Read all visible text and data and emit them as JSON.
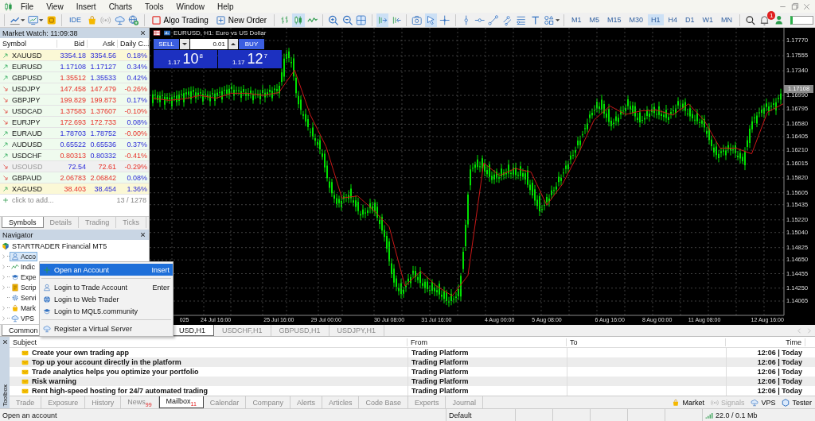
{
  "menu": [
    "File",
    "View",
    "Insert",
    "Charts",
    "Tools",
    "Window",
    "Help"
  ],
  "toolbar": {
    "ide": "IDE",
    "algo_trading": {
      "label": "Algo Trading",
      "on": false
    },
    "new_order": "New Order",
    "chart_modes": [
      {
        "selected": false
      },
      {
        "selected": true
      },
      {
        "selected": false
      }
    ],
    "autoscroll": {
      "on": true
    },
    "chart_shift": {
      "on": false
    },
    "pointer_tools": [
      {
        "selected": true
      },
      {
        "selected": false
      }
    ],
    "timeframes": [
      {
        "label": "M1",
        "selected": false
      },
      {
        "label": "M5",
        "selected": false
      },
      {
        "label": "M15",
        "selected": false
      },
      {
        "label": "M30",
        "selected": false
      },
      {
        "label": "H1",
        "selected": true
      },
      {
        "label": "H4",
        "selected": false
      },
      {
        "label": "D1",
        "selected": false
      },
      {
        "label": "W1",
        "selected": false
      },
      {
        "label": "MN",
        "selected": false
      }
    ],
    "notifications": "1"
  },
  "market_watch": {
    "title": "Market Watch: 11:09:38",
    "columns": [
      "Symbol",
      "Bid",
      "Ask",
      "Daily C..."
    ],
    "rows": [
      {
        "symbol": "XAUUSD",
        "trend_up": true,
        "bid": "3354.18",
        "bid_up": true,
        "ask": "3354.56",
        "ask_up": true,
        "change": "0.18%",
        "change_up": true,
        "highlighted": true,
        "disabled": false
      },
      {
        "symbol": "EURUSD",
        "trend_up": true,
        "bid": "1.17108",
        "bid_up": true,
        "ask": "1.17127",
        "ask_up": true,
        "change": "0.34%",
        "change_up": true,
        "highlighted": false,
        "disabled": false
      },
      {
        "symbol": "GBPUSD",
        "trend_up": true,
        "bid": "1.35512",
        "bid_up": false,
        "ask": "1.35533",
        "ask_up": true,
        "change": "0.42%",
        "change_up": true,
        "highlighted": false,
        "disabled": false
      },
      {
        "symbol": "USDJPY",
        "trend_up": false,
        "bid": "147.458",
        "bid_up": false,
        "ask": "147.479",
        "ask_up": false,
        "change": "-0.26%",
        "change_up": false,
        "highlighted": false,
        "disabled": false
      },
      {
        "symbol": "GBPJPY",
        "trend_up": false,
        "bid": "199.829",
        "bid_up": false,
        "ask": "199.873",
        "ask_up": false,
        "change": "0.17%",
        "change_up": true,
        "highlighted": false,
        "disabled": false
      },
      {
        "symbol": "USDCAD",
        "trend_up": false,
        "bid": "1.37583",
        "bid_up": false,
        "ask": "1.37607",
        "ask_up": false,
        "change": "-0.10%",
        "change_up": false,
        "highlighted": false,
        "disabled": false
      },
      {
        "symbol": "EURJPY",
        "trend_up": false,
        "bid": "172.693",
        "bid_up": false,
        "ask": "172.733",
        "ask_up": false,
        "change": "0.08%",
        "change_up": true,
        "highlighted": false,
        "disabled": false
      },
      {
        "symbol": "EURAUD",
        "trend_up": true,
        "bid": "1.78703",
        "bid_up": true,
        "ask": "1.78752",
        "ask_up": true,
        "change": "-0.00%",
        "change_up": false,
        "highlighted": false,
        "disabled": false
      },
      {
        "symbol": "AUDUSD",
        "trend_up": true,
        "bid": "0.65522",
        "bid_up": true,
        "ask": "0.65536",
        "ask_up": true,
        "change": "0.37%",
        "change_up": true,
        "highlighted": false,
        "disabled": false
      },
      {
        "symbol": "USDCHF",
        "trend_up": true,
        "bid": "0.80313",
        "bid_up": false,
        "ask": "0.80332",
        "ask_up": true,
        "change": "-0.41%",
        "change_up": false,
        "highlighted": false,
        "disabled": false
      },
      {
        "symbol": "USOUSD",
        "trend_up": false,
        "bid": "72.54",
        "bid_up": true,
        "ask": "72.61",
        "ask_up": false,
        "change": "-0.29%",
        "change_up": false,
        "highlighted": false,
        "disabled": true
      },
      {
        "symbol": "GBPAUD",
        "trend_up": false,
        "bid": "2.06783",
        "bid_up": false,
        "ask": "2.06842",
        "ask_up": false,
        "change": "0.08%",
        "change_up": true,
        "highlighted": false,
        "disabled": false
      },
      {
        "symbol": "XAGUSD",
        "trend_up": true,
        "bid": "38.403",
        "bid_up": false,
        "ask": "38.454",
        "ask_up": true,
        "change": "1.36%",
        "change_up": true,
        "highlighted": true,
        "disabled": false
      }
    ],
    "add_label": "click to add...",
    "count": "13 / 1278",
    "tabs": [
      {
        "label": "Symbols",
        "selected": true
      },
      {
        "label": "Details",
        "selected": false
      },
      {
        "label": "Trading",
        "selected": false
      },
      {
        "label": "Ticks",
        "selected": false
      }
    ]
  },
  "navigator": {
    "title": "Navigator",
    "root": {
      "label": "STARTRADER Financial MT5",
      "children": [
        {
          "label": "Acco",
          "selected": true,
          "expandable": true
        },
        {
          "label": "Indic",
          "selected": false,
          "expandable": true
        },
        {
          "label": "Expe",
          "selected": false,
          "expandable": true
        },
        {
          "label": "Scrip",
          "selected": false,
          "expandable": true
        },
        {
          "label": "Servi",
          "selected": false,
          "expandable": false
        },
        {
          "label": "Mark",
          "selected": false,
          "expandable": true
        },
        {
          "label": "VPS",
          "selected": false,
          "expandable": true
        }
      ]
    },
    "tabs": [
      {
        "label": "Common",
        "selected": true
      }
    ]
  },
  "context_menu": {
    "items": [
      {
        "kind": "item",
        "label": "Open an Account",
        "shortcut": "Insert",
        "selected": true
      },
      {
        "kind": "separator"
      },
      {
        "kind": "item",
        "label": "Login to Trade Account",
        "shortcut": "Enter",
        "selected": false
      },
      {
        "kind": "item",
        "label": "Login to Web Trader",
        "selected": false
      },
      {
        "kind": "item",
        "label": "Login to MQL5.community",
        "selected": false
      },
      {
        "kind": "separator"
      },
      {
        "kind": "item",
        "label": "Register a Virtual Server",
        "selected": false
      }
    ]
  },
  "chart": {
    "title": "EURUSD, H1:  Euro vs US Dollar",
    "trade_panel": {
      "sell": "SELL",
      "buy": "BUY",
      "volume": "0.01",
      "sell_price": {
        "prefix": "1.17",
        "digits": "10",
        "pip": "8"
      },
      "buy_price": {
        "prefix": "1.17",
        "digits": "12",
        "pip": "7"
      }
    },
    "chart_data": {
      "type": "line",
      "categories": [
        null,
        null,
        "025",
        null,
        "24 Jul 16:00",
        null,
        null,
        null,
        "25 Jul 16:00",
        null,
        null,
        "29 Jul 00:00",
        null,
        null,
        null,
        "30 Jul 08:00",
        null,
        null,
        "31 Jul 16:00",
        null,
        null,
        null,
        "4 Aug 00:00",
        null,
        null,
        "5 Aug 08:00",
        null,
        null,
        null,
        "6 Aug 16:00",
        null,
        null,
        "8 Aug 00:00",
        null,
        null,
        "11 Aug 08:00",
        null,
        null,
        null,
        "12 Aug 16:00",
        null
      ],
      "ylim": [
        1.13862,
        1.17951
      ],
      "grid": true,
      "series": [
        {
          "color": "#c81818",
          "values": [
            1.1695,
            1.1692,
            1.1694,
            1.1699,
            1.1695,
            1.1702,
            1.1702,
            1.1699,
            1.1703,
            1.1735,
            1.1671,
            1.1626,
            1.1553,
            1.1556,
            1.1536,
            1.1512,
            1.1428,
            1.1449,
            1.1428,
            1.1414,
            1.1443,
            1.1603,
            1.1585,
            1.1595,
            1.159,
            1.1543,
            1.1573,
            1.1616,
            1.1664,
            1.1684,
            1.1672,
            1.1677,
            1.1678,
            1.1671,
            1.1687,
            1.1663,
            1.1624,
            1.1624,
            1.1616,
            1.1675,
            1.1687
          ]
        }
      ],
      "yticks": [
        {
          "value": 1.1777,
          "label": "1.17770"
        },
        {
          "value": 1.17555,
          "label": "1.17555"
        },
        {
          "value": 1.1734,
          "label": "1.17340"
        },
        {
          "value": 1.1699,
          "label": "1.16990"
        },
        {
          "value": 1.16795,
          "label": "1.16795"
        },
        {
          "value": 1.1658,
          "label": "1.16580"
        },
        {
          "value": 1.16405,
          "label": "1.16405"
        },
        {
          "value": 1.1621,
          "label": "1.16210"
        },
        {
          "value": 1.16015,
          "label": "1.16015"
        },
        {
          "value": 1.1582,
          "label": "1.15820"
        },
        {
          "value": 1.15605,
          "label": "1.15605"
        },
        {
          "value": 1.15435,
          "label": "1.15435"
        },
        {
          "value": 1.1522,
          "label": "1.15220"
        },
        {
          "value": 1.1504,
          "label": "1.15040"
        },
        {
          "value": 1.14825,
          "label": "1.14825"
        },
        {
          "value": 1.1465,
          "label": "1.14650"
        },
        {
          "value": 1.14455,
          "label": "1.14455"
        },
        {
          "value": 1.1425,
          "label": "1.14250"
        },
        {
          "value": 1.14065,
          "label": "1.14065"
        }
      ]
    },
    "current_price": "1.17108",
    "tabs": [
      {
        "label": "USD,H1",
        "selected": true
      },
      {
        "label": "USDCHF,H1",
        "selected": false
      },
      {
        "label": "GBPUSD,H1",
        "selected": false
      },
      {
        "label": "USDJPY,H1",
        "selected": false
      }
    ]
  },
  "toolbox": {
    "title": "Toolbox",
    "columns": [
      "Subject",
      "From",
      "To",
      "Time"
    ],
    "rows": [
      {
        "subject": "Create your own trading app",
        "from": "Trading Platform",
        "time": "12:06 | Today"
      },
      {
        "subject": "Top up your account directly in the platform",
        "from": "Trading Platform",
        "time": "12:06 | Today"
      },
      {
        "subject": "Trade analytics helps you optimize your portfolio",
        "from": "Trading Platform",
        "time": "12:06 | Today"
      },
      {
        "subject": "Risk warning",
        "from": "Trading Platform",
        "time": "12:06 | Today"
      },
      {
        "subject": "Rent high-speed hosting for 24/7 automated trading",
        "from": "Trading Platform",
        "time": "12:06 | Today"
      }
    ],
    "tabs": [
      {
        "label": "Trade",
        "selected": false
      },
      {
        "label": "Exposure",
        "selected": false
      },
      {
        "label": "History",
        "selected": false
      },
      {
        "label": "News",
        "badge": "99",
        "selected": false
      },
      {
        "label": "Mailbox",
        "badge": "11",
        "selected": true
      },
      {
        "label": "Calendar",
        "selected": false
      },
      {
        "label": "Company",
        "selected": false
      },
      {
        "label": "Alerts",
        "selected": false
      },
      {
        "label": "Articles",
        "selected": false
      },
      {
        "label": "Code Base",
        "selected": false
      },
      {
        "label": "Experts",
        "selected": false
      },
      {
        "label": "Journal",
        "selected": false
      }
    ],
    "services": [
      {
        "label": "Market",
        "disabled": false
      },
      {
        "label": "Signals",
        "disabled": true
      },
      {
        "label": "VPS",
        "disabled": false
      },
      {
        "label": "Tester",
        "disabled": false
      }
    ]
  },
  "status_bar": {
    "hint": "Open an account",
    "profile": "Default",
    "traffic": "22.0 / 0.1 Mb"
  }
}
